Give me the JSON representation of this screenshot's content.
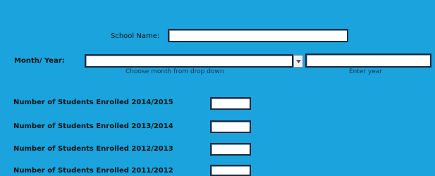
{
  "form": {
    "school_name_label": "School Name:",
    "school_name_value": "",
    "month_year_label": "Month/ Year:",
    "month_value": "",
    "month_hint": "Choose month from drop down",
    "year_value": "",
    "year_hint": "Enter year",
    "enrollment_rows": [
      {
        "label": "Number of Students Enrolled 2014/2015",
        "value": ""
      },
      {
        "label": "Number of Students Enrolled 2013/2014",
        "value": ""
      },
      {
        "label": "Number of Students Enrolled 2012/2013",
        "value": ""
      },
      {
        "label": "Number of Students Enrolled 2011/2012",
        "value": ""
      }
    ]
  },
  "colors": {
    "panel_background": "#1aa3dc",
    "field_border": "#1a2a3f"
  },
  "icons": {
    "dropdown": "chevron-down-icon"
  }
}
